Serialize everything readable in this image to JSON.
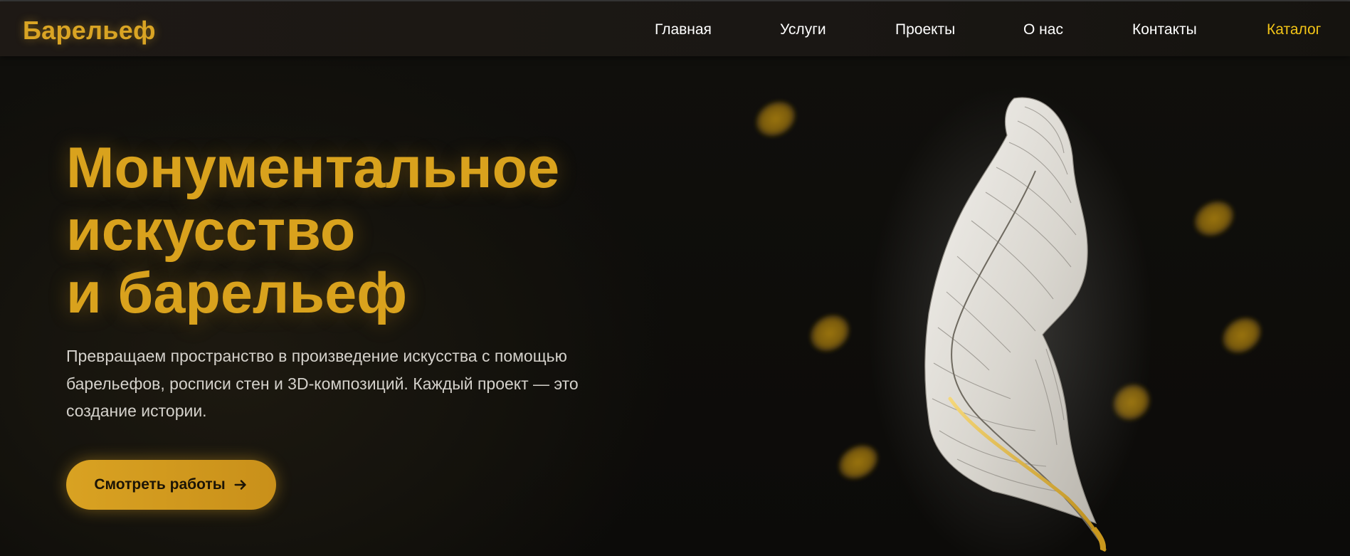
{
  "brand": {
    "logo_text": "Барельеф",
    "accent_color": "#d9a424"
  },
  "nav": {
    "items": [
      {
        "label": "Главная"
      },
      {
        "label": "Услуги"
      },
      {
        "label": "Проекты"
      },
      {
        "label": "О нас"
      },
      {
        "label": "Контакты"
      },
      {
        "label": "Каталог",
        "highlighted": true
      }
    ]
  },
  "hero": {
    "headline_lines": [
      "Монументальное",
      "искусство",
      "и барельеф"
    ],
    "subtext": "Превращаем пространство в произведение искусства с помощью барельефов, росписи стен и 3D-композиций. Каждый проект — это создание истории.",
    "cta_label": "Смотреть работы",
    "cta_icon": "arrow-right-icon",
    "illustration": "white-gold-feather-relief"
  }
}
